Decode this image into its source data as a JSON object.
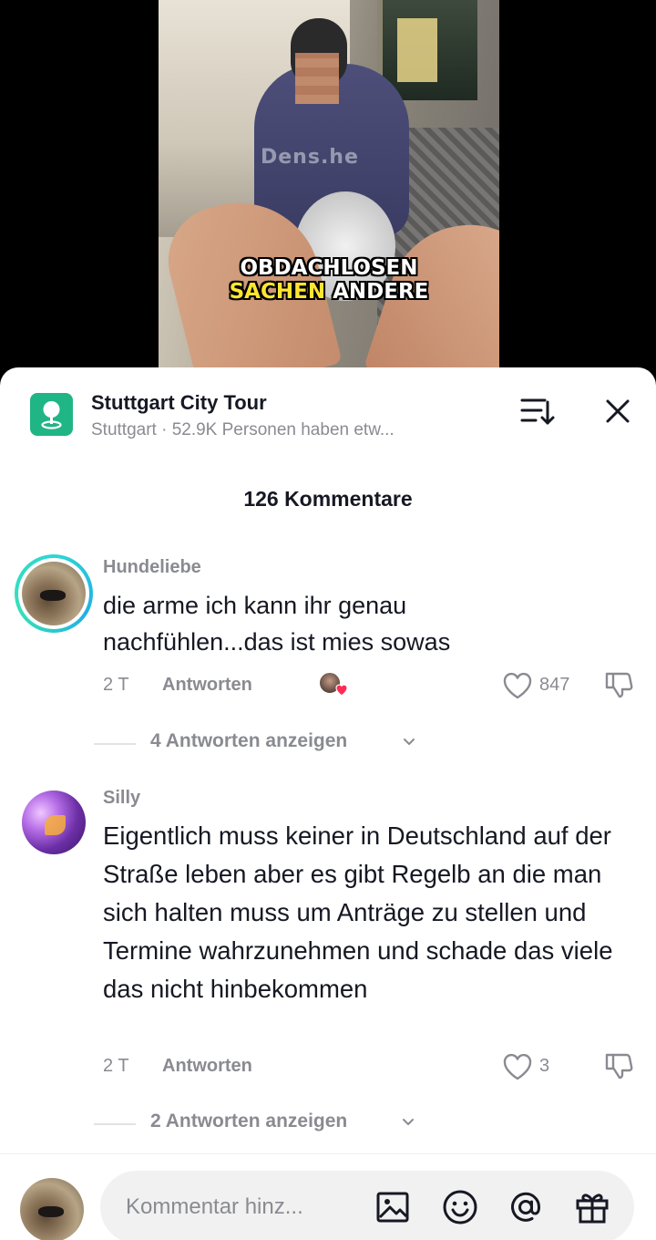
{
  "video": {
    "watermark": "Dens.he",
    "caption_line1": "OBDACHLOSEN",
    "caption_line2_highlight": "SACHEN",
    "caption_line2_rest": "ANDERE"
  },
  "location": {
    "title": "Stuttgart City Tour",
    "subtitle": "Stuttgart · 52.9K Personen haben etw..."
  },
  "comments_header": {
    "count_label": "126 Kommentare"
  },
  "comments": [
    {
      "username": "Hundeliebe",
      "text": "die arme ich kann ihr genau nachfühlen...das ist mies sowas",
      "time": "2 T",
      "reply_label": "Antworten",
      "likes": "847",
      "replies_label": "4 Antworten anzeigen"
    },
    {
      "username": "Silly",
      "text": "Eigentlich muss keiner in Deutschland auf der Straße leben aber es gibt Regelb an die man sich halten muss um Anträge zu stellen und Termine wahrzunehmen und schade das viele das nicht hinbekommen",
      "time": "2 T",
      "reply_label": "Antworten",
      "likes": "3",
      "replies_label": "2 Antworten anzeigen"
    }
  ],
  "composer": {
    "placeholder": "Kommentar hinz..."
  },
  "colors": {
    "accent_green": "#20b584",
    "like_heart": "#fe2c55",
    "ring": "#2fd6d4",
    "muted_text": "#8a8b91"
  },
  "icons": [
    "location-pin-icon",
    "sort-icon",
    "close-icon",
    "heart-outline-icon",
    "dislike-icon",
    "chevron-down-icon",
    "image-icon",
    "emoji-icon",
    "at-icon",
    "gift-icon"
  ]
}
